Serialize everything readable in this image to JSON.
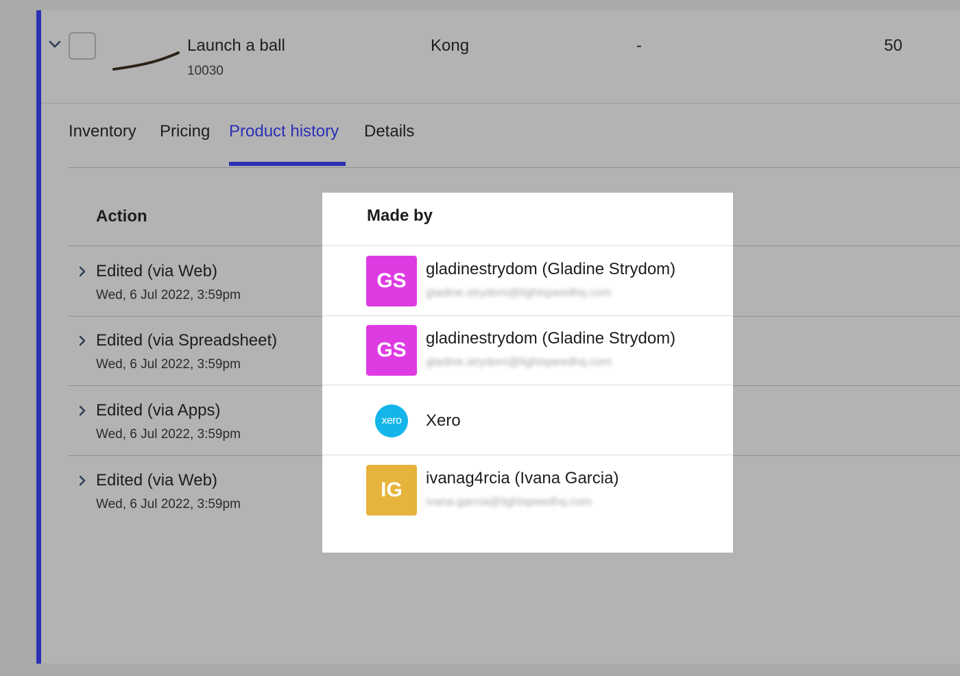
{
  "product": {
    "name": "Launch a ball",
    "sku": "10030",
    "brand": "Kong",
    "dash": "-",
    "quantity": "50"
  },
  "tabs": [
    {
      "label": "Inventory",
      "active": false
    },
    {
      "label": "Pricing",
      "active": false
    },
    {
      "label": "Product history",
      "active": true
    },
    {
      "label": "Details",
      "active": false
    }
  ],
  "table": {
    "headers": {
      "action": "Action",
      "made_by": "Made by"
    },
    "rows": [
      {
        "action": "Edited (via Web)",
        "date": "Wed, 6 Jul 2022, 3:59pm",
        "initials": "GS",
        "user": "gladinestrydom (Gladine Strydom)",
        "email": "gladine.strydom@lightspeedhq.com",
        "avatar_color": "#de3be3"
      },
      {
        "action": "Edited (via Spreadsheet)",
        "date": "Wed, 6 Jul 2022, 3:59pm",
        "initials": "GS",
        "user": "gladinestrydom (Gladine Strydom)",
        "email": "gladine.strydom@lightspeedhq.com",
        "avatar_color": "#de3be3"
      },
      {
        "action": "Edited (via Apps)",
        "date": "Wed, 6 Jul 2022, 3:59pm",
        "logo_text": "xero",
        "user": "Xero",
        "avatar_color": "#13b5ea"
      },
      {
        "action": "Edited (via Web)",
        "date": "Wed, 6 Jul 2022, 3:59pm",
        "initials": "IG",
        "user": "ivanag4rcia (Ivana Garcia)",
        "email": "ivana.garcia@lightspeedhq.com",
        "avatar_color": "#e6b43c"
      }
    ]
  },
  "colors": {
    "accent": "#2b2fb4",
    "overlay_bg": "#b3b3b3",
    "spotlight_bg": "#ffffff"
  },
  "icons": {
    "expand": "chevron-down-icon",
    "row_expand": "chevron-right-icon"
  }
}
